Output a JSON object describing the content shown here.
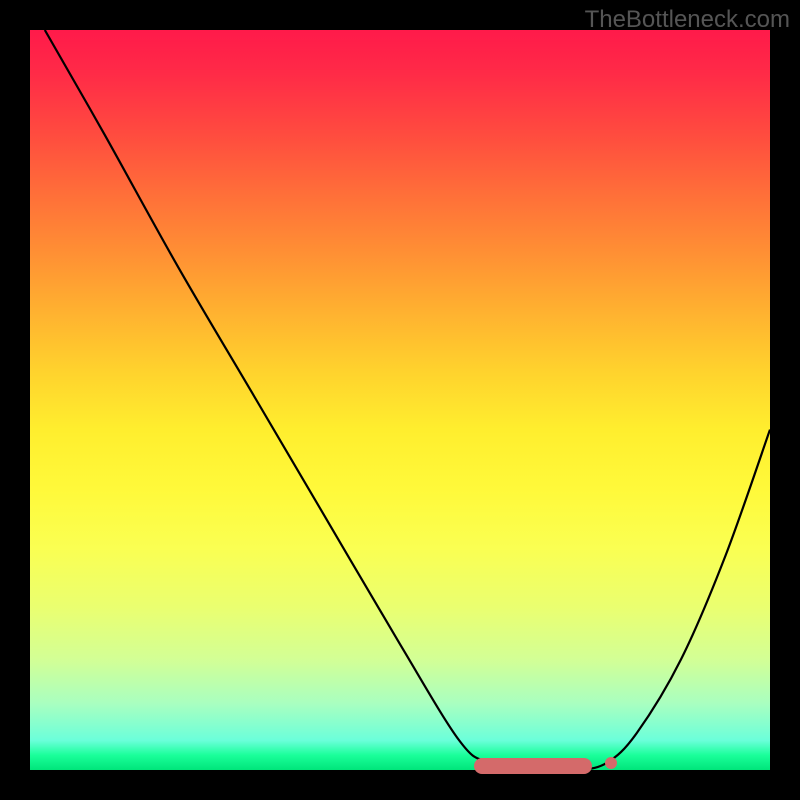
{
  "watermark": "TheBottleneck.com",
  "chart_data": {
    "type": "line",
    "title": "",
    "xlabel": "",
    "ylabel": "",
    "xlim": [
      0,
      100
    ],
    "ylim": [
      0,
      100
    ],
    "grid": false,
    "legend": false,
    "series": [
      {
        "name": "curve",
        "x": [
          2,
          10,
          20,
          30,
          40,
          50,
          58,
          62,
          68,
          74,
          78,
          82,
          88,
          94,
          100
        ],
        "y": [
          100,
          86,
          68,
          51,
          34,
          17,
          4,
          1,
          0,
          0,
          1,
          5,
          15,
          29,
          46
        ]
      }
    ],
    "annotations": {
      "plateau_bar": {
        "x_start": 60,
        "x_end": 76,
        "y": 0.5
      },
      "marker_dot": {
        "x": 78.5,
        "y": 1
      }
    },
    "background_gradient": {
      "top": "#ff1a4a",
      "mid": "#fff93a",
      "bottom": "#00e57a"
    },
    "colors": {
      "line": "#000000",
      "marker": "#d46a6a",
      "frame": "#000000"
    }
  }
}
